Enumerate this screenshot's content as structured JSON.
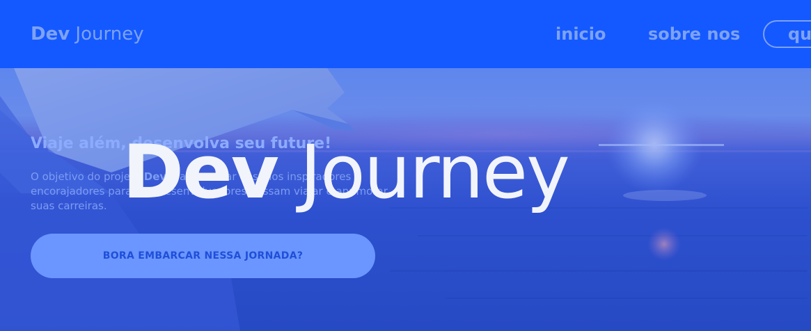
{
  "header": {
    "brand_bold": "Dev",
    "brand_light": " Journey",
    "nav": {
      "inicio": "inicio",
      "sobre_nos": "sobre nos",
      "pill_partial": "qu"
    }
  },
  "hero": {
    "heading": "Viaje além, desenvolva seu future!",
    "desc_part1": "O objetivo do projeto ",
    "desc_bold": "Dev",
    "desc_part2": " é apresentar destinos inspiradores e encorajadores para que desenvolvedores possam viajar e aprimorar suas carreiras.",
    "cta_label": "BORA EMBARCAR NESSA JORNADA?"
  },
  "overlay_logo": {
    "bold": "Dev",
    "light": " Journey"
  },
  "colors": {
    "header_bg": "#1459ff",
    "header_text": "#7ea2f5",
    "hero_overlay": "#2b59e8",
    "cta_bg": "#6b96ff",
    "cta_text": "#1f4fd9",
    "logo_text": "#f2f4fb"
  },
  "icons": [
    "airplane-wing-image",
    "sun-flare"
  ]
}
